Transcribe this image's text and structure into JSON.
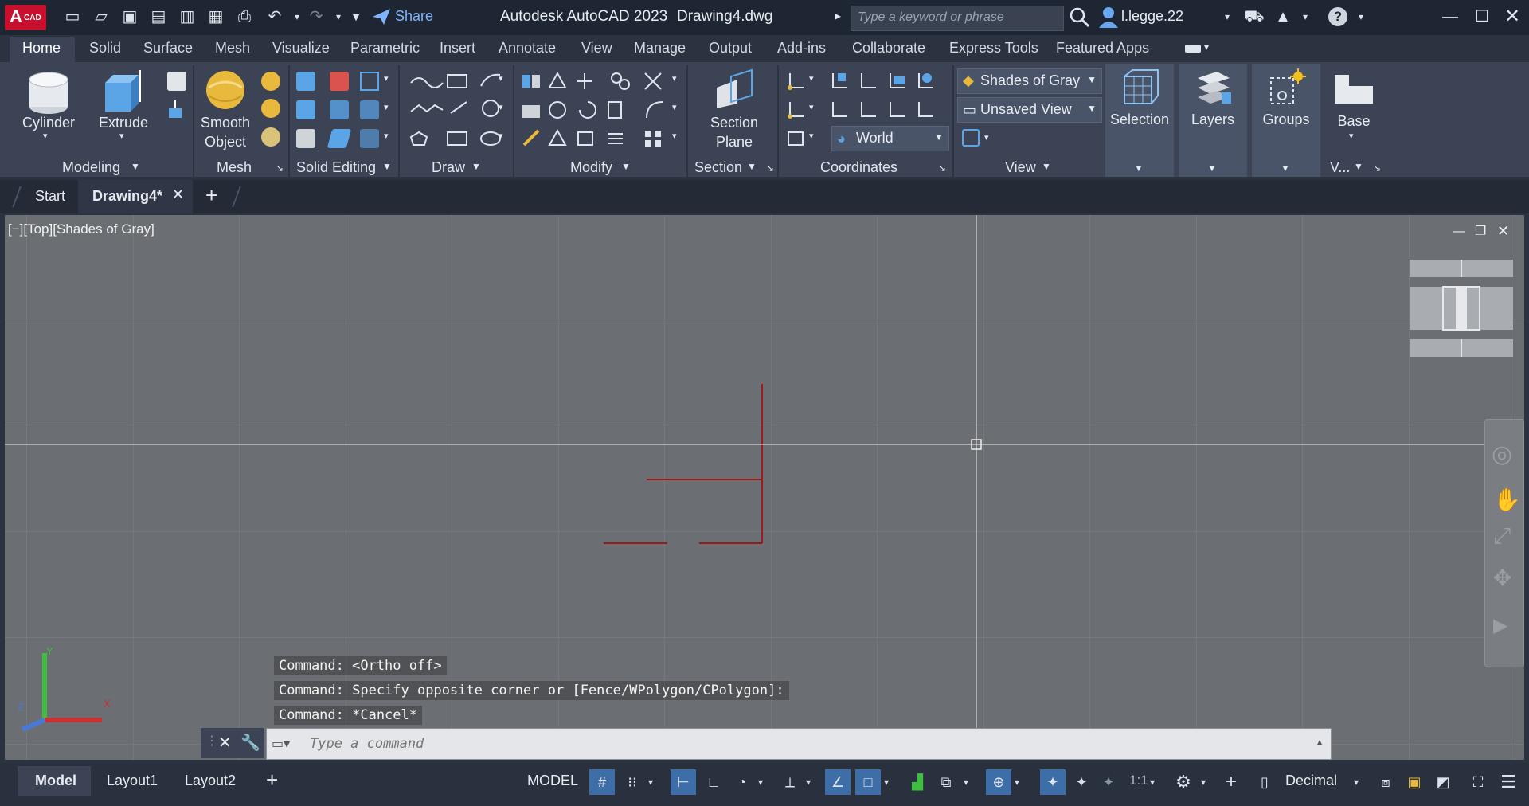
{
  "titlebar": {
    "logo_main": "A",
    "logo_sub": "CAD",
    "share_label": "Share",
    "app_title": "Autodesk AutoCAD 2023",
    "doc_title": "Drawing4.dwg",
    "search_placeholder": "Type a keyword or phrase",
    "user": "l.legge.22"
  },
  "menu_tabs": [
    "Home",
    "Solid",
    "Surface",
    "Mesh",
    "Visualize",
    "Parametric",
    "Insert",
    "Annotate",
    "View",
    "Manage",
    "Output",
    "Add-ins",
    "Collaborate",
    "Express Tools",
    "Featured Apps"
  ],
  "ribbon": {
    "cylinder": "Cylinder",
    "extrude": "Extrude",
    "smooth_object_1": "Smooth",
    "smooth_object_2": "Object",
    "section_plane_1": "Section",
    "section_plane_2": "Plane",
    "visual_style": "Shades of Gray",
    "named_view": "Unsaved View",
    "ucs": "World",
    "selection": "Selection",
    "layers": "Layers",
    "groups": "Groups",
    "base": "Base",
    "panels": {
      "modeling": "Modeling",
      "mesh": "Mesh",
      "solid_editing": "Solid Editing",
      "draw": "Draw",
      "modify": "Modify",
      "section": "Section",
      "coordinates": "Coordinates",
      "view": "View",
      "v_short": "V..."
    }
  },
  "doc_tabs": {
    "start": "Start",
    "active": "Drawing4*"
  },
  "viewport": {
    "label": "[−][Top][Shades of Gray]"
  },
  "command": {
    "history": [
      "Command:  <Ortho off>",
      "Command: Specify opposite corner or [Fence/WPolygon/CPolygon]:",
      "Command: *Cancel*"
    ],
    "placeholder": "Type a command"
  },
  "status": {
    "tabs": [
      "Model",
      "Layout1",
      "Layout2"
    ],
    "model_label": "MODEL",
    "scale": "1:1",
    "units": "Decimal"
  },
  "colors": {
    "accent": "#3d6ea8",
    "drawing_lines": "#a01818",
    "viewport_bg": "#6b6e73"
  }
}
